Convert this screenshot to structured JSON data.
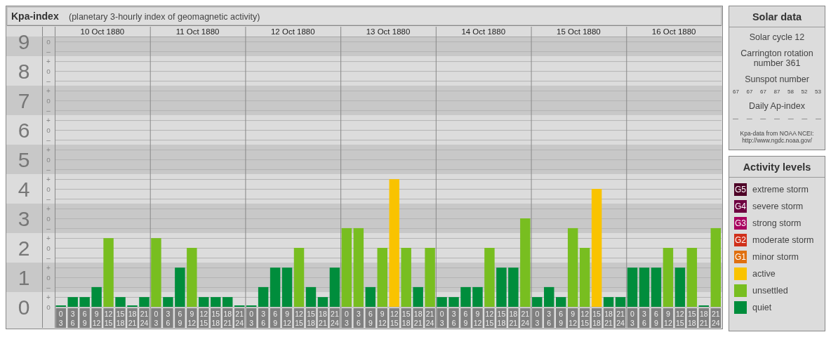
{
  "kpa_panel": {
    "title": "Kpa-index",
    "subtitle": "(planetary 3-hourly index of geomagnetic activity)",
    "days": [
      "10 Oct 1880",
      "11 Oct 1880",
      "12 Oct 1880",
      "13 Oct 1880",
      "14 Oct 1880",
      "15 Oct 1880",
      "16 Oct 1880"
    ],
    "minor_tick_labels": [
      "o",
      "–",
      "+",
      "o",
      "–",
      "+",
      "o",
      "–",
      "+",
      "o",
      "–",
      "+",
      "o",
      "–",
      "+",
      "o",
      "–",
      "+",
      "o",
      "–",
      "+",
      "o",
      "–",
      "+",
      "o",
      "–",
      "+",
      "o"
    ],
    "chart_data": {
      "type": "bar",
      "stacked": true,
      "grid": true,
      "ylim": [
        0,
        9.17
      ],
      "yticks": [
        {
          "value": 9,
          "label": "9"
        },
        {
          "value": 8,
          "label": "8"
        },
        {
          "value": 7,
          "label": "7"
        },
        {
          "value": 6,
          "label": "6"
        },
        {
          "value": 5,
          "label": "5"
        },
        {
          "value": 4,
          "label": "4"
        },
        {
          "value": 3,
          "label": "3"
        },
        {
          "value": 2,
          "label": "2"
        },
        {
          "value": 1,
          "label": "1"
        },
        {
          "value": 0,
          "label": "0"
        }
      ],
      "categories": [
        "0 3",
        "3 6",
        "6 9",
        "9 12",
        "12 15",
        "15 18",
        "18 21",
        "21 24",
        "0 3",
        "3 6",
        "6 9",
        "9 12",
        "12 15",
        "15 18",
        "18 21",
        "21 24",
        "0 3",
        "3 6",
        "6 9",
        "9 12",
        "12 15",
        "15 18",
        "18 21",
        "21 24",
        "0 3",
        "3 6",
        "6 9",
        "9 12",
        "12 15",
        "15 18",
        "18 21",
        "21 24",
        "0 3",
        "3 6",
        "6 9",
        "9 12",
        "12 15",
        "15 18",
        "18 21",
        "21 24",
        "0 3",
        "3 6",
        "6 9",
        "9 12",
        "12 15",
        "15 18",
        "18 21",
        "21 24",
        "0 3",
        "3 6",
        "6 9",
        "9 12",
        "12 15",
        "15 18",
        "18 21",
        "21 24"
      ],
      "series": [
        {
          "name": "quiet",
          "color": "#008d3c",
          "values": [
            0,
            0.33,
            0.33,
            0.67,
            null,
            0.33,
            0,
            0.33,
            null,
            0.33,
            1.33,
            null,
            0.33,
            0.33,
            0.33,
            0,
            0,
            0.67,
            1.33,
            1.33,
            null,
            0.67,
            0.33,
            1.33,
            null,
            null,
            0.67,
            null,
            null,
            null,
            0.67,
            null,
            0.33,
            0.33,
            0.67,
            0.67,
            null,
            1.33,
            1.33,
            null,
            0.33,
            0.67,
            0.33,
            null,
            null,
            null,
            0.33,
            0.33,
            1.33,
            1.33,
            1.33,
            null,
            1.33,
            null,
            0,
            null
          ]
        },
        {
          "name": "unsettled",
          "color": "#78be20",
          "values": [
            null,
            null,
            null,
            null,
            2.33,
            null,
            null,
            null,
            2.33,
            null,
            null,
            2,
            null,
            null,
            null,
            null,
            null,
            null,
            null,
            null,
            2,
            null,
            null,
            null,
            2.67,
            2.67,
            null,
            2,
            null,
            2,
            null,
            2,
            null,
            null,
            null,
            null,
            2,
            null,
            null,
            3,
            null,
            null,
            null,
            2.67,
            2,
            null,
            null,
            null,
            null,
            null,
            null,
            2,
            null,
            2,
            null,
            2.67
          ]
        },
        {
          "name": "active",
          "color": "#f9c300",
          "values": [
            null,
            null,
            null,
            null,
            null,
            null,
            null,
            null,
            null,
            null,
            null,
            null,
            null,
            null,
            null,
            null,
            null,
            null,
            null,
            null,
            null,
            null,
            null,
            null,
            null,
            null,
            null,
            null,
            4.33,
            null,
            null,
            null,
            null,
            null,
            null,
            null,
            null,
            null,
            null,
            null,
            null,
            null,
            null,
            null,
            null,
            4,
            null,
            null,
            null,
            null,
            null,
            null,
            null,
            null,
            null,
            null
          ]
        }
      ]
    }
  },
  "solar_data": {
    "title": "Solar data",
    "solar_cycle": "Solar cycle 12",
    "carrington": "Carrington rotation number 361",
    "sunspot_heading": "Sunspot number",
    "sunspots": [
      "67",
      "67",
      "67",
      "87",
      "58",
      "52",
      "53"
    ],
    "ap_heading": "Daily Ap-index",
    "ap_values": [
      "—",
      "—",
      "—",
      "—",
      "—",
      "—",
      "—"
    ],
    "source": "Kpa-data from NOAA NCEI:",
    "source_url": "http://www.ngdc.noaa.gov/"
  },
  "activity_levels": {
    "title": "Activity levels",
    "items": [
      {
        "kind": "badge",
        "badge": "G5",
        "label": "extreme storm",
        "color": "#4d0026"
      },
      {
        "kind": "badge",
        "badge": "G4",
        "label": "severe storm",
        "color": "#6e0040"
      },
      {
        "kind": "badge",
        "badge": "G3",
        "label": "strong storm",
        "color": "#a8005f"
      },
      {
        "kind": "badge",
        "badge": "G2",
        "label": "moderate storm",
        "color": "#d0301a"
      },
      {
        "kind": "badge",
        "badge": "G1",
        "label": "minor storm",
        "color": "#e07010"
      }
    ]
  }
}
